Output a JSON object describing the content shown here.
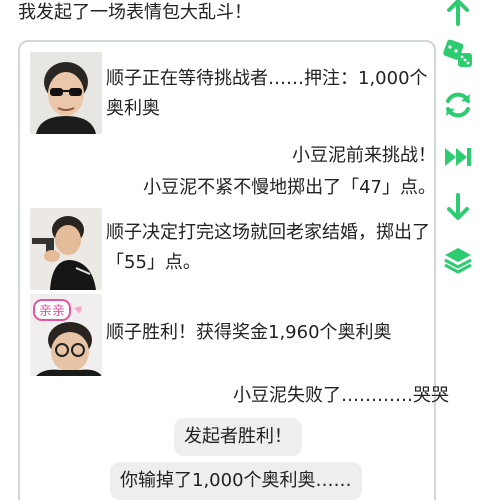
{
  "header": {
    "message": "我发起了一场表情包大乱斗！"
  },
  "feed": {
    "line1": "顺子正在等待挑战者……押注：1,000个奥利奥",
    "line2": "小豆泥前来挑战！",
    "line3": "小豆泥不紧不慢地掷出了「47」点。",
    "line4": "顺子决定打完这场就回老家结婚，掷出了「55」点。",
    "line5": "顺子胜利！获得奖金1,960个奥利奥",
    "line6": "小豆泥失败了…………哭哭",
    "pill1": "发起者胜利！",
    "pill2": "你输掉了1,000个奥利奥……"
  },
  "avatar3_sticker_text": "亲亲",
  "colors": {
    "accent": "#2ecc71",
    "card_border": "#cfd8d2",
    "pill_bg": "#eeeeee"
  },
  "side_icons": [
    "arrow-up-icon",
    "dice-icon",
    "refresh-icon",
    "fast-forward-icon",
    "arrow-down-icon",
    "layers-icon"
  ]
}
